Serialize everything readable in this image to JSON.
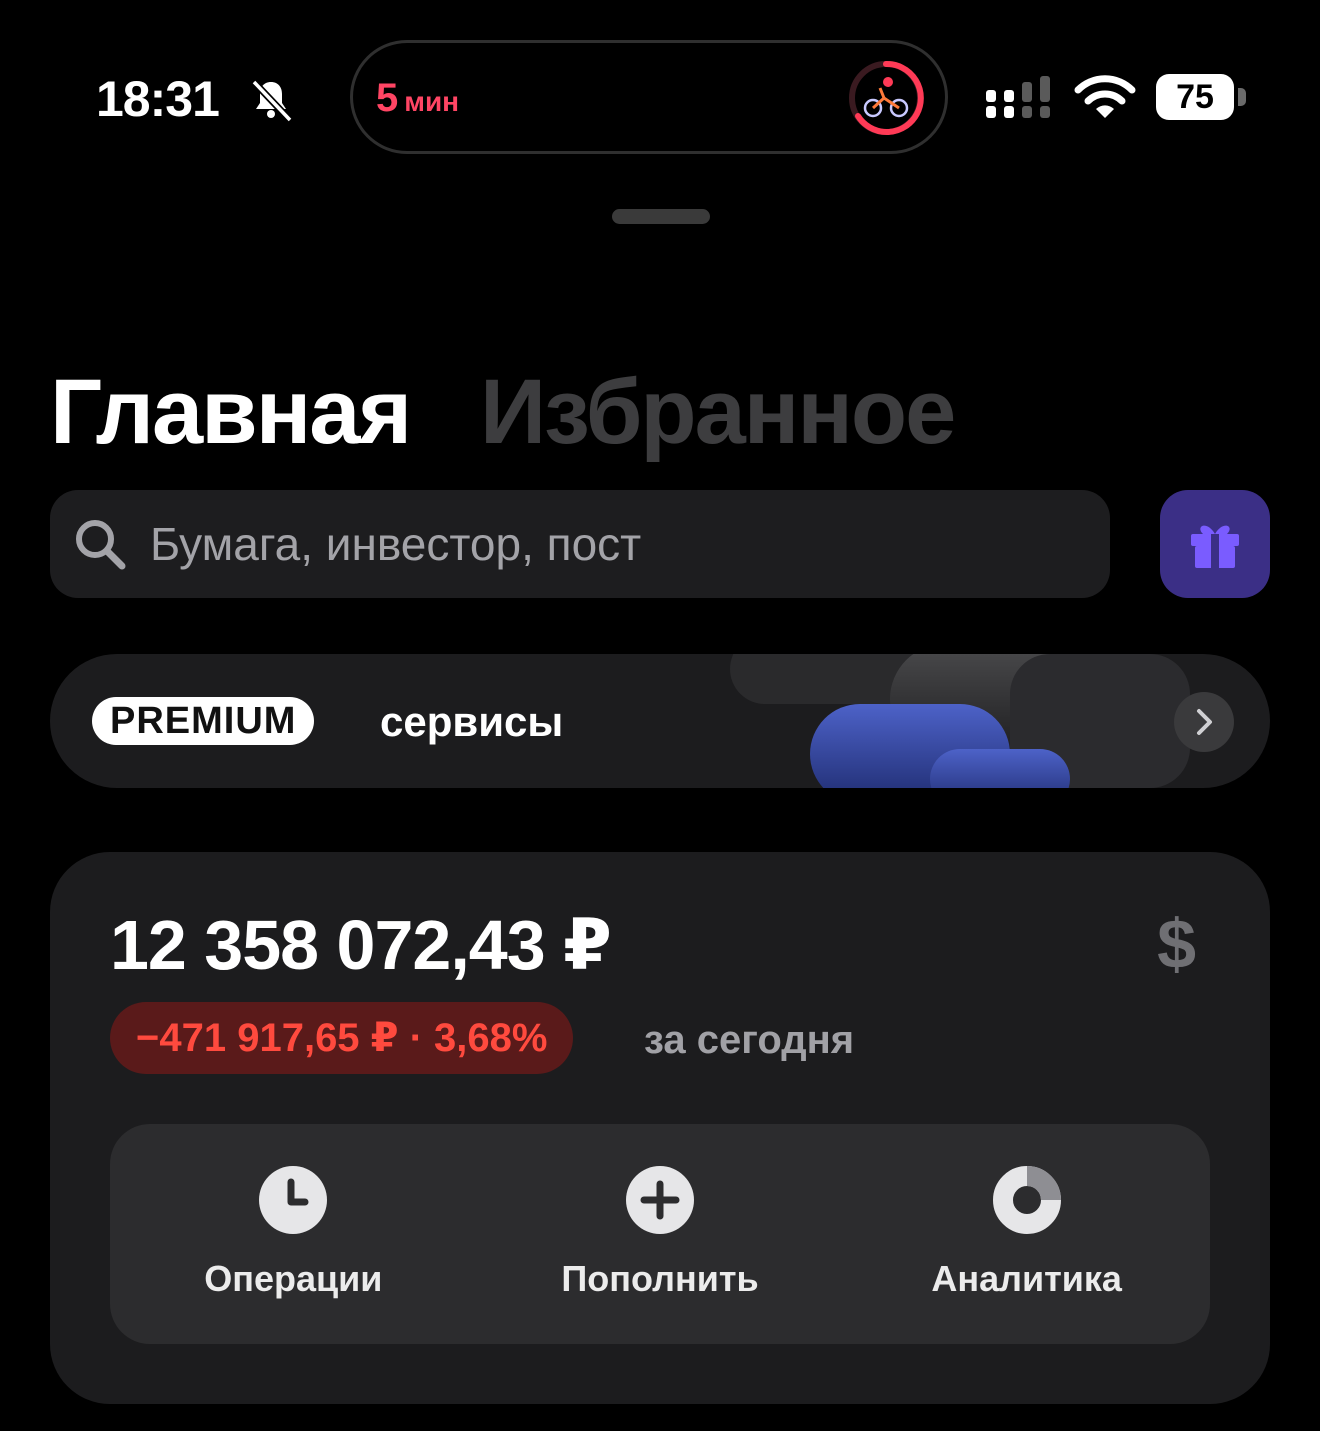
{
  "status_bar": {
    "time": "18:31",
    "timer_value": "5",
    "timer_unit": "мин",
    "battery": "75",
    "icons": [
      "bell-slash-icon",
      "cycling-activity-icon",
      "signal-icon",
      "wifi-icon",
      "battery-icon"
    ]
  },
  "tabs": [
    {
      "label": "Главная",
      "active": true
    },
    {
      "label": "Избранное",
      "active": false
    }
  ],
  "search": {
    "placeholder": "Бумага, инвестор, пост"
  },
  "premium": {
    "badge": "PREMIUM",
    "label": "сервисы"
  },
  "portfolio": {
    "amount": "12 358 072,43 ₽",
    "currency_switch": "$",
    "change": "−471 917,65 ₽ · 3,68%",
    "period": "за сегодня"
  },
  "actions": [
    {
      "label": "Операции",
      "icon": "clock-icon"
    },
    {
      "label": "Пополнить",
      "icon": "plus-circle-icon"
    },
    {
      "label": "Аналитика",
      "icon": "donut-chart-icon"
    }
  ],
  "colors": {
    "accent_red": "#ff4a3e",
    "timer_red": "#ff4564",
    "gift_bg": "#3b2f86",
    "card_bg": "#1c1c1e"
  }
}
